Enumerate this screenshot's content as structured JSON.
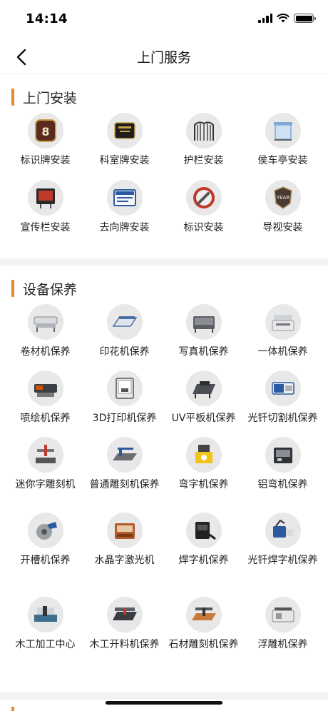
{
  "status": {
    "time": "14:14"
  },
  "nav": {
    "title": "上门服务"
  },
  "colors": {
    "accent": "#e98a2a",
    "divider": "#f3f3f3"
  },
  "sections": [
    {
      "title": "上门安装",
      "items": [
        {
          "label": "标识牌安装",
          "icon": "sign-plaque-8f-icon"
        },
        {
          "label": "科室牌安装",
          "icon": "office-plaque-icon"
        },
        {
          "label": "护栏安装",
          "icon": "railing-gate-icon"
        },
        {
          "label": "侯车亭安装",
          "icon": "bus-shelter-icon"
        },
        {
          "label": "宣传栏安装",
          "icon": "bulletin-board-icon"
        },
        {
          "label": "去向牌安装",
          "icon": "direction-board-icon"
        },
        {
          "label": "标识安装",
          "icon": "wrench-badge-icon"
        },
        {
          "label": "导视安装",
          "icon": "year-badge-icon"
        }
      ]
    },
    {
      "title": "设备保养",
      "items": [
        {
          "label": "卷材机保养",
          "icon": "roll-printer-icon"
        },
        {
          "label": "印花机保养",
          "icon": "flatbed-printer-icon"
        },
        {
          "label": "写真机保养",
          "icon": "photo-printer-icon"
        },
        {
          "label": "一体机保养",
          "icon": "all-in-one-printer-icon"
        },
        {
          "label": "喷绘机保养",
          "icon": "inkjet-printer-icon"
        },
        {
          "label": "3D打印机保养",
          "icon": "3d-printer-icon"
        },
        {
          "label": "UV平板机保养",
          "icon": "uv-flatbed-icon"
        },
        {
          "label": "光钎切割机保养",
          "icon": "fiber-cutter-icon"
        },
        {
          "label": "迷你字雕刻机",
          "icon": "mini-engraver-icon"
        },
        {
          "label": "普通雕刻机保养",
          "icon": "engraver-icon"
        },
        {
          "label": "弯字机保养",
          "icon": "letter-bender-icon"
        },
        {
          "label": "铝弯机保养",
          "icon": "aluminum-bender-icon"
        },
        {
          "label": "开槽机保养",
          "icon": "groove-cutter-icon"
        },
        {
          "label": "水晶字激光机",
          "icon": "laser-machine-icon"
        },
        {
          "label": "焊字机保养",
          "icon": "welder-icon"
        },
        {
          "label": "光钎焊字机保养",
          "icon": "fiber-welder-icon"
        },
        {
          "label": "木工加工中心",
          "icon": "woodworking-center-icon"
        },
        {
          "label": "木工开料机保养",
          "icon": "wood-cutter-icon"
        },
        {
          "label": "石材雕刻机保养",
          "icon": "stone-engraver-icon"
        },
        {
          "label": "浮雕机保养",
          "icon": "relief-machine-icon"
        }
      ]
    }
  ]
}
